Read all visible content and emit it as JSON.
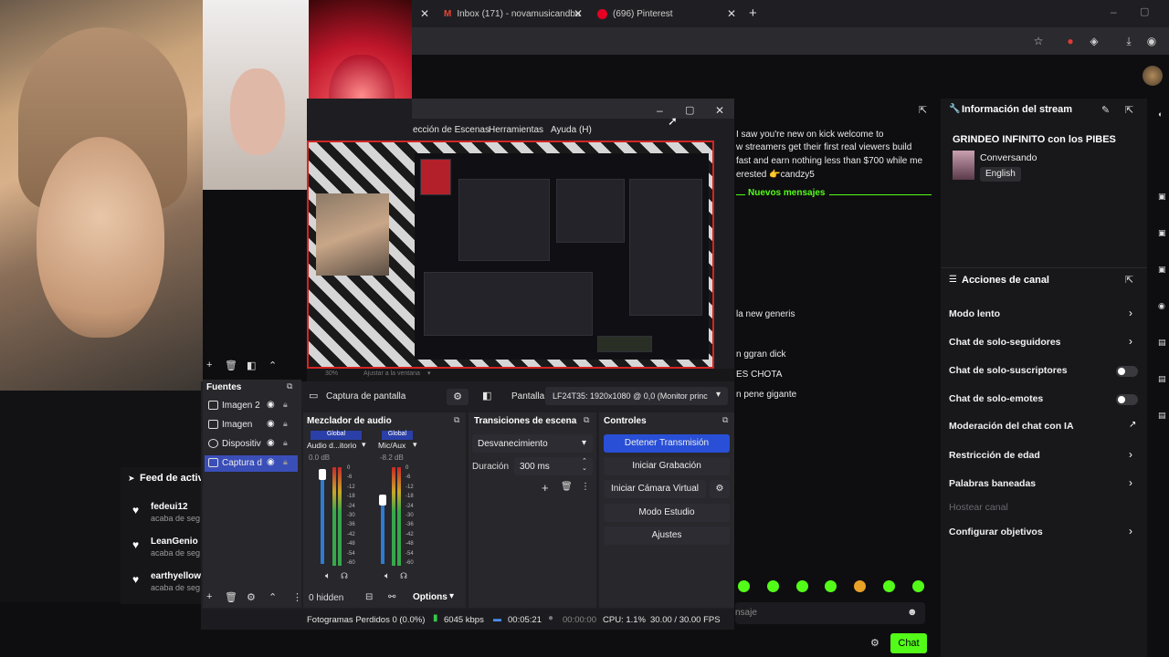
{
  "browser": {
    "tabs": [
      {
        "label": "Inbox (171) - novamusicandbu",
        "icon": "gmail-icon"
      },
      {
        "label": "(696) Pinterest",
        "icon": "pinterest-icon"
      }
    ]
  },
  "obs": {
    "menu": [
      "ección de Escenas",
      "Herramientas",
      "Ayuda (H)"
    ],
    "preview_zoom": "30%",
    "preview_fit": "Ajustar a la ventana",
    "source_toolbar": {
      "selected_source": "Captura de pantalla",
      "pantalla_label": "Pantalla",
      "pantalla_value": "LF24T35: 1920x1080 @ 0,0 (Monitor princ"
    },
    "fuentes": {
      "title": "Fuentes",
      "items": [
        "Imagen 2",
        "Imagen",
        "Dispositiv",
        "Captura d"
      ]
    },
    "mixer": {
      "title": "Mezclador de audio",
      "channels": [
        {
          "badge": "Global",
          "name": "Audio d...itorio",
          "db": "0.0 dB"
        },
        {
          "badge": "Global",
          "name": "Mic/Aux",
          "db": "-8.2 dB"
        }
      ],
      "hidden": "0 hidden",
      "options": "Options",
      "ticks": [
        "0",
        "-6",
        "-12",
        "-18",
        "-24",
        "-30",
        "-36",
        "-42",
        "-48",
        "-54",
        "-60"
      ]
    },
    "transitions": {
      "title": "Transiciones de escena",
      "selected": "Desvanecimiento",
      "duration_label": "Duración",
      "duration_value": "300 ms"
    },
    "controls": {
      "title": "Controles",
      "buttons": [
        "Detener Transmisión",
        "Iniciar Grabación",
        "Iniciar Cámara Virtual",
        "Modo Estudio",
        "Ajustes"
      ]
    },
    "status": {
      "dropped": "Fotogramas Perdidos 0 (0.0%)",
      "kbps": "6045 kbps",
      "stream_time": "00:05:21",
      "rec_time": "00:00:00",
      "cpu": "CPU: 1.1%",
      "fps": "30.00 / 30.00 FPS"
    }
  },
  "kick": {
    "feed": {
      "title": "Feed de activi",
      "items": [
        {
          "name": "fedeui12",
          "sub": "acaba de seg"
        },
        {
          "name": "LeanGenio",
          "sub": "acaba de seg"
        },
        {
          "name": "earthyellow",
          "sub": "acaba de seg"
        }
      ]
    },
    "chat": {
      "spam": [
        "I saw you're new on kick welcome to",
        "w streamers get their first real viewers build",
        "fast and earn nothing less than $700 while me",
        "erested 👉candzy5"
      ],
      "new_messages": "Nuevos mensajes",
      "lines": [
        "la new generis",
        "n ggran dick",
        "ES CHOTA",
        "n pene gigante"
      ],
      "input_placeholder": "nsaje",
      "send": "Chat"
    },
    "stream_info": {
      "title": "Información del stream",
      "stream_title": "GRINDEO INFINITO con los PIBES",
      "category": "Conversando",
      "language": "English"
    },
    "channel_actions": {
      "title": "Acciones de canal",
      "items": [
        {
          "label": "Modo lento",
          "control": "chevron"
        },
        {
          "label": "Chat de solo-seguidores",
          "control": "chevron"
        },
        {
          "label": "Chat de solo-suscriptores",
          "control": "toggle"
        },
        {
          "label": "Chat de solo-emotes",
          "control": "toggle"
        },
        {
          "label": "Moderación del chat con IA",
          "control": "external"
        },
        {
          "label": "Restricción de edad",
          "control": "chevron"
        },
        {
          "label": "Palabras baneadas",
          "control": "chevron"
        },
        {
          "label": "Hostear canal",
          "control": "none"
        },
        {
          "label": "Configurar objetivos",
          "control": "chevron"
        }
      ]
    }
  },
  "colors": {
    "kick_green": "#53fc18",
    "obs_blue": "#284fd6",
    "live_red": "#d42424"
  }
}
